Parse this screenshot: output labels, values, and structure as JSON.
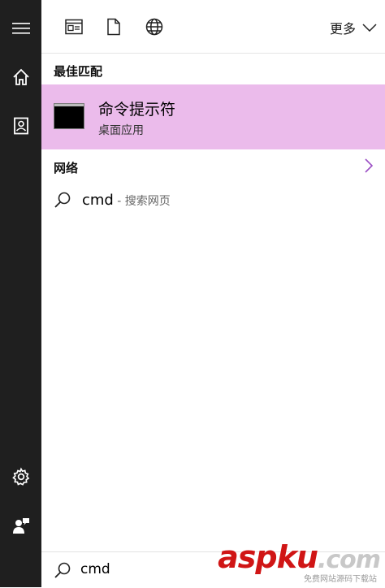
{
  "toolbar": {
    "more_label": "更多"
  },
  "best_match": {
    "heading": "最佳匹配",
    "app_title": "命令提示符",
    "app_subtitle": "桌面应用"
  },
  "web": {
    "heading": "网络",
    "query": "cmd",
    "suffix": " - 搜索网页"
  },
  "search": {
    "value": "cmd"
  },
  "watermark": {
    "main": "aspku",
    "dot": ".com",
    "sub": "免费网站源码下载站"
  },
  "colors": {
    "sidebar_bg": "#1f1f1f",
    "highlight_bg": "#ebbbeb",
    "chevron": "#9b4fc4"
  },
  "icons": {
    "sidebar": [
      "hamburger-menu-icon",
      "home-icon",
      "notebook-icon",
      "settings-gear-icon",
      "user-feedback-icon"
    ],
    "toolbar": [
      "apps-filter-icon",
      "documents-filter-icon",
      "web-filter-icon",
      "chevron-down-icon"
    ],
    "results": [
      "command-prompt-icon",
      "chevron-right-icon",
      "search-magnifier-icon"
    ]
  }
}
